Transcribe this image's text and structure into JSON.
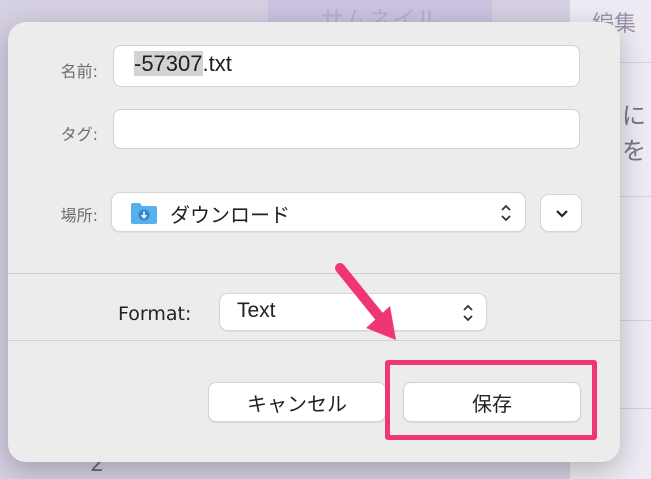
{
  "background": {
    "tab_label": "サムネイル",
    "panel_label": "編集",
    "panel_text": "に を",
    "row_number": "2"
  },
  "dialog": {
    "name_label": "名前:",
    "name_selected": "-57307",
    "name_ext": ".txt",
    "tag_label": "タグ:",
    "tag_value": "",
    "location_label": "場所:",
    "location_value": "ダウンロード",
    "format_label": "Format:",
    "format_value": "Text",
    "cancel_label": "キャンセル",
    "save_label": "保存"
  },
  "colors": {
    "accent_annotation": "#ef3576",
    "folder_icon": "#5ab0ee"
  },
  "icons": [
    "folder-download-icon",
    "updown-chevron-icon",
    "chevron-down-icon",
    "arrow-annotation-icon"
  ]
}
